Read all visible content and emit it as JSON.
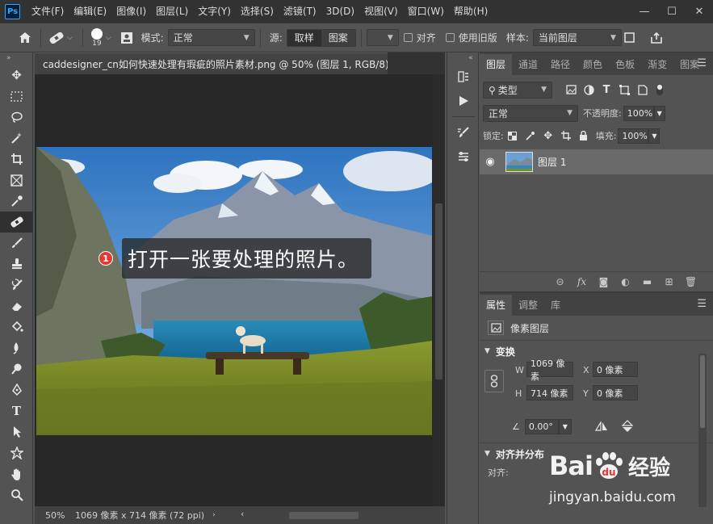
{
  "app": {
    "logo": "Ps"
  },
  "menu": [
    "文件(F)",
    "编辑(E)",
    "图像(I)",
    "图层(L)",
    "文字(Y)",
    "选择(S)",
    "滤镜(T)",
    "3D(D)",
    "视图(V)",
    "窗口(W)",
    "帮助(H)"
  ],
  "window_controls": {
    "minimize": "—",
    "maximize": "☐",
    "close": "✕"
  },
  "options": {
    "brush_size": "19",
    "mode_label": "模式:",
    "mode_value": "正常",
    "source_label": "源:",
    "source_options": [
      "取样",
      "图案"
    ],
    "align_label": "对齐",
    "legacy_label": "使用旧版",
    "sample_label": "样本:",
    "sample_value": "当前图层"
  },
  "document": {
    "tab_title": "caddesigner_cn如何快速处理有瑕疵的照片素材.png @ 50% (图层 1, RGB/8)",
    "tab_close": "×",
    "zoom": "50%",
    "status_info": "1069 像素 x 714 像素 (72 ppi)"
  },
  "annotation": {
    "number": "1",
    "text": "打开一张要处理的照片。"
  },
  "layers_panel": {
    "tabs": [
      "图层",
      "通道",
      "路径",
      "颜色",
      "色板",
      "渐变",
      "图案"
    ],
    "filter_label": "类型",
    "blend_mode": "正常",
    "opacity_label": "不透明度:",
    "opacity_value": "100%",
    "lock_label": "锁定:",
    "fill_label": "填充:",
    "fill_value": "100%",
    "layers": [
      {
        "name": "图层 1",
        "visible": true
      }
    ]
  },
  "properties_panel": {
    "tabs": [
      "属性",
      "调整",
      "库"
    ],
    "type_label": "像素图层",
    "transform_title": "变换",
    "w_label": "W",
    "w_value": "1069 像素",
    "h_label": "H",
    "h_value": "714 像素",
    "x_label": "X",
    "x_value": "0 像素",
    "y_label": "Y",
    "y_value": "0 像素",
    "angle_value": "0.00°",
    "align_title": "对齐并分布",
    "align_label": "对齐:"
  },
  "watermark": {
    "brand": "Bai",
    "brand_cn": "经验",
    "url": "jingyan.baidu.com"
  },
  "colors": {
    "accent": "#31a8ff",
    "badge": "#e53935",
    "panel": "#535353",
    "dark": "#323232"
  }
}
